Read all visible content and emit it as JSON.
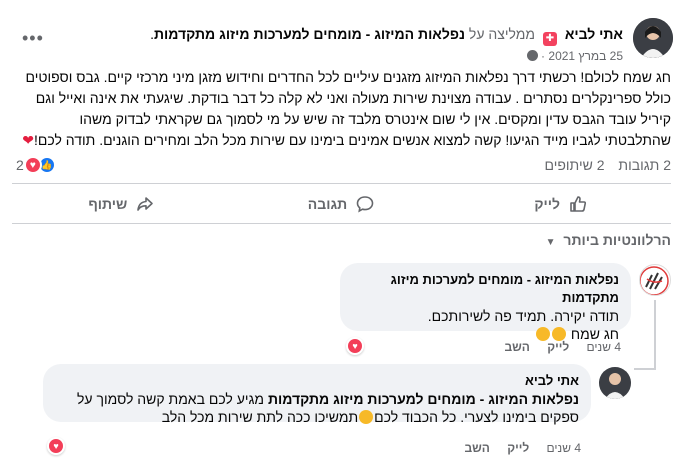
{
  "post": {
    "author": "אתי לביא",
    "verb": "ממליצה על",
    "page": "נפלאות המיזוג - מומחים למערכות מיזוג מתקדמות",
    "date": "25 במרץ 2021",
    "date_sep": "·",
    "text_lines": [
      "חג שמח לכולם! רכשתי דרך נפלאות המיזוג מזגנים עיליים לכל החדרים וחידוש מזגן מיני מרכזי קיים. גבס וספוטים",
      "כולל ספרינקלרים נסתרים . עבודה מצוינת שירות מעולה ואני לא קלה כל דבר בודקת. שיגעתי את אינה ואייל וגם",
      "קיריל עובד הגבס עדין ומקסים. אין לי שום אינטרס מלבד זה שיש על מי לסמוך גם שקראתי לבדוק משהו",
      "שהתלבטתי לגביו מייד הגיעו! קשה למצוא אנשים אמינים בימינו עם שירות מכל הלב ומחירים הוגנים. תודה לכם!"
    ],
    "heart": "❤"
  },
  "stats": {
    "reactions_count": "2",
    "comments": "2 תגובות",
    "shares": "2 שיתופים"
  },
  "actions": {
    "like": "לייק",
    "comment": "תגובה",
    "share": "שיתוף"
  },
  "relevance": {
    "label": "הרלוונטיות ביותר",
    "caret": "▼"
  },
  "comments": [
    {
      "author": "נפלאות המיזוג - מומחים למערכות מיזוג מתקדמות",
      "line1": "תודה יקירה. תמיד פה לשירותכם.",
      "line2": "חג שמח",
      "like": "לייק",
      "reply": "השב",
      "time": "4 שנים"
    },
    {
      "author": "אתי לביא",
      "mention": "נפלאות המיזוג - מומחים למערכות מיזוג מתקדמות",
      "text_a": " מגיע לכם באמת קשה לסמוך על",
      "text_b": "ספקים בימינו לצערי. כל הכבוד לכם",
      "text_c": "תמשיכו ככה לתת שירות מכל הלב",
      "like": "לייק",
      "reply": "השב",
      "time": "4 שנים"
    }
  ],
  "icons": {
    "more": "more-horizontal-icon",
    "globe": "globe-icon",
    "recommend": "recommend-icon",
    "like": "thumbs-up-icon",
    "comment": "comment-icon",
    "share": "share-icon"
  },
  "colors": {
    "like_blue": "#1877f2",
    "love_red": "#f33e58",
    "text_secondary": "#65676b",
    "bubble_bg": "#f0f2f5"
  }
}
